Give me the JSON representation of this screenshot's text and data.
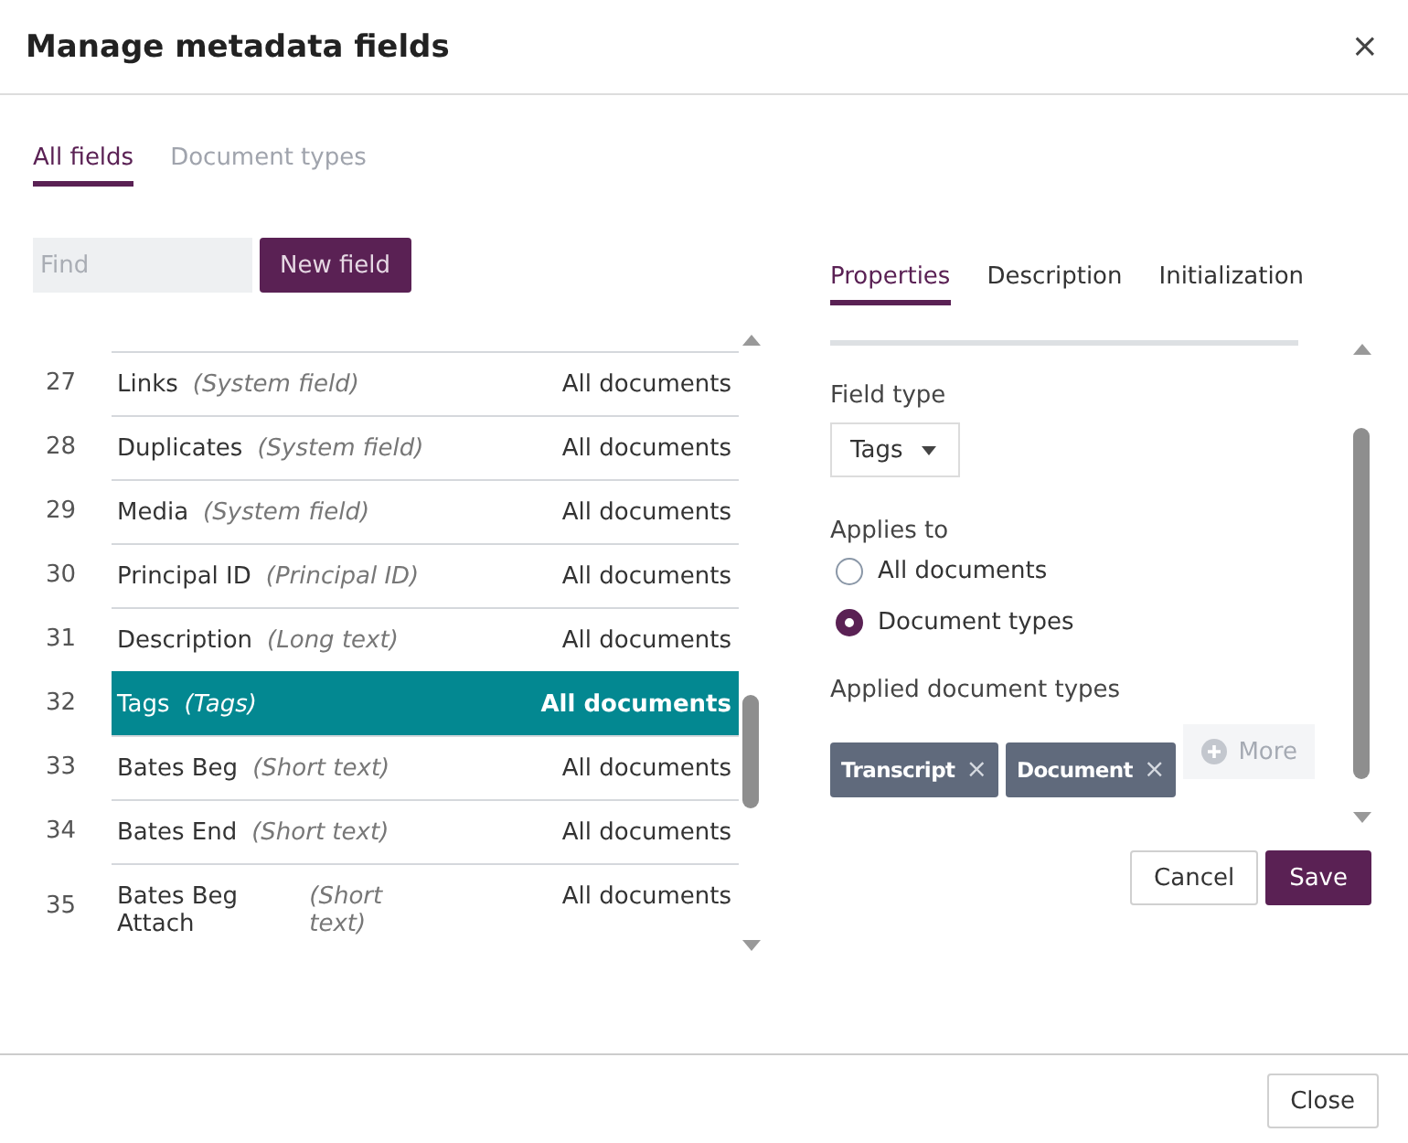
{
  "dialog": {
    "title": "Manage metadata fields",
    "close_glyph": "×"
  },
  "tabs": [
    {
      "label": "All fields",
      "selected": true
    },
    {
      "label": "Document types",
      "selected": false
    }
  ],
  "find": {
    "placeholder": "Find"
  },
  "new_field_button": "New field",
  "fields": [
    {
      "number": "27",
      "name": "Links",
      "type": "(System field)",
      "applies": "All documents",
      "selected": false
    },
    {
      "number": "28",
      "name": "Duplicates",
      "type": "(System field)",
      "applies": "All documents",
      "selected": false
    },
    {
      "number": "29",
      "name": "Media",
      "type": "(System field)",
      "applies": "All documents",
      "selected": false
    },
    {
      "number": "30",
      "name": "Principal ID",
      "type": "(Principal ID)",
      "applies": "All documents",
      "selected": false
    },
    {
      "number": "31",
      "name": "Description",
      "type": "(Long text)",
      "applies": "All documents",
      "selected": false
    },
    {
      "number": "32",
      "name": "Tags",
      "type": "(Tags)",
      "applies": "All documents",
      "selected": true
    },
    {
      "number": "33",
      "name": "Bates Beg",
      "type": "(Short text)",
      "applies": "All documents",
      "selected": false
    },
    {
      "number": "34",
      "name": "Bates End",
      "type": "(Short text)",
      "applies": "All documents",
      "selected": false
    },
    {
      "number": "35",
      "name": "Bates Beg Attach",
      "type": "(Short text)",
      "applies": "All documents",
      "selected": false
    }
  ],
  "detail_tabs": [
    {
      "label": "Properties",
      "selected": true
    },
    {
      "label": "Description",
      "selected": false
    },
    {
      "label": "Initialization",
      "selected": false
    }
  ],
  "properties": {
    "field_type_label": "Field type",
    "field_type": "Tags",
    "applies_label": "Applies to",
    "applies_options": [
      {
        "label": "All documents",
        "selected": false
      },
      {
        "label": "Document types",
        "selected": true
      }
    ],
    "applied_types_label": "Applied document types",
    "applied_types": [
      {
        "label": "Transcript",
        "remove_glyph": "×"
      },
      {
        "label": "Document",
        "remove_glyph": "×"
      }
    ],
    "more_button": "More"
  },
  "cancel_button": "Cancel",
  "save_button": "Save",
  "close_button": "Close"
}
